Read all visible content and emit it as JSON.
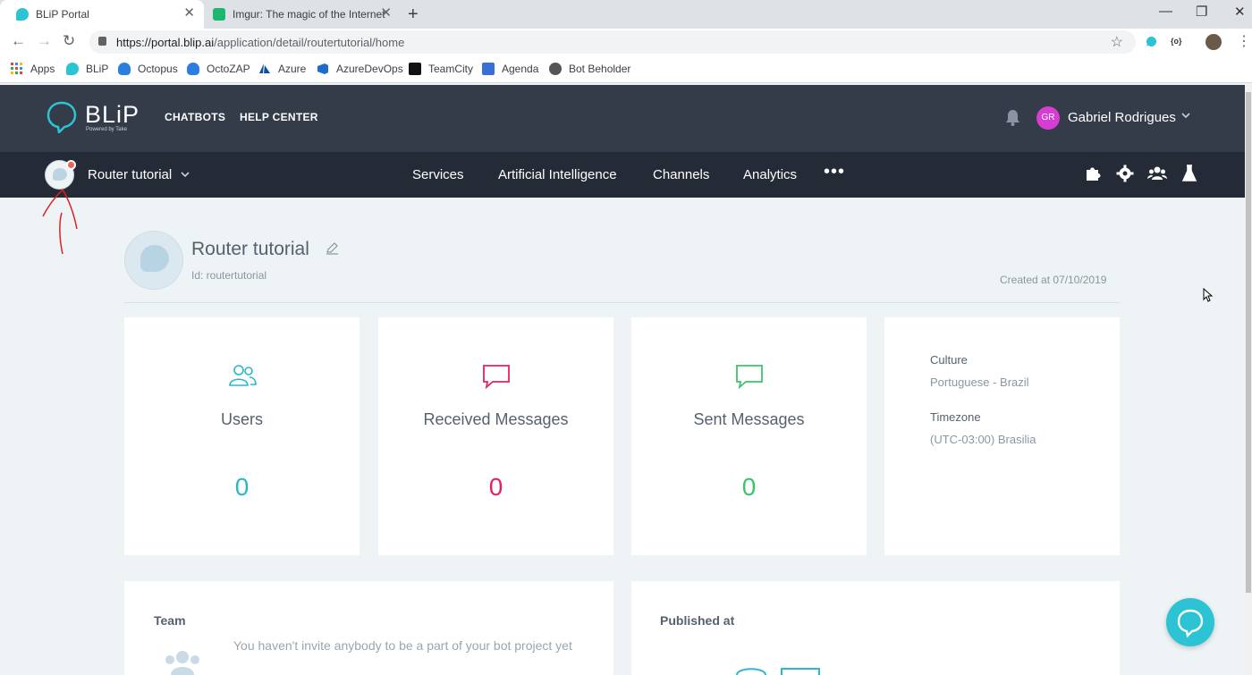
{
  "browser": {
    "tabs": [
      {
        "title": "BLiP Portal",
        "active": true
      },
      {
        "title": "Imgur: The magic of the Internet",
        "active": false
      }
    ],
    "url_host": "https://portal.blip.ai",
    "url_path": "/application/detail/routertutorial/home",
    "bookmarks": [
      "Apps",
      "BLiP",
      "Octopus",
      "OctoZAP",
      "Azure",
      "AzureDevOps",
      "TeamCity",
      "Agenda",
      "Bot Beholder"
    ],
    "extension_label": "{o}"
  },
  "header": {
    "logo": "BLiP",
    "logo_tagline": "Powered by Take",
    "links": [
      "CHATBOTS",
      "HELP CENTER"
    ],
    "user": {
      "initials": "GR",
      "name": "Gabriel Rodrigues"
    }
  },
  "subnav": {
    "bot_name": "Router tutorial",
    "links": [
      "Services",
      "Artificial Intelligence",
      "Channels",
      "Analytics"
    ],
    "more": "•••"
  },
  "bot": {
    "title": "Router tutorial",
    "id_label": "Id: routertutorial",
    "created_label": "Created at  07/10/2019"
  },
  "stats": [
    {
      "label": "Users",
      "value": "0",
      "color": "#2cb7c9"
    },
    {
      "label": "Received Messages",
      "value": "0",
      "color": "#e0245e"
    },
    {
      "label": "Sent Messages",
      "value": "0",
      "color": "#3cc46a"
    }
  ],
  "info": {
    "culture_label": "Culture",
    "culture_value": "Portuguese - Brazil",
    "timezone_label": "Timezone",
    "timezone_value": "(UTC-03:00) Brasilia"
  },
  "team": {
    "title": "Team",
    "message": "You haven't invite anybody to be a part of your bot project yet"
  },
  "published": {
    "title": "Published at"
  },
  "colors": {
    "header_bg": "#333c48",
    "subnav_bg": "#252b36",
    "accent": "#2cc3d5",
    "page_bg": "#eef3f6"
  }
}
